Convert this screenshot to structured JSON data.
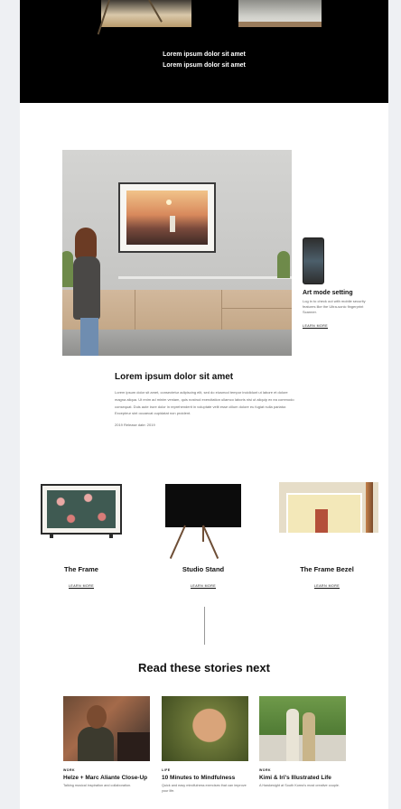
{
  "hero": {
    "line1": "Lorem ipsum dolor sit amet",
    "line2": "Lorem ipsum dolor sit amet"
  },
  "art_mode": {
    "title": "Art mode setting",
    "description": "Log in to check out with mobile security features like the Ultra-sonic fingerprint Scanner.",
    "link": "LEARN MORE"
  },
  "article": {
    "title": "Lorem ipsum dolor sit amet",
    "body": "Lorem ipsum dolor sit amet, consectetur adipiscing elit, sed do eiusmod tempor incididunt ut labore et dolore magna aliqua. Ut enim ad minim veniam, quis nostrud exercitation ullamco laboris nisi ut aliquip ex ea commodo consequat. Duis aute irure dolor in reprehenderit in voluptate velit esse cillum dolore eu fugiat nulla pariatur. Excepteur sint occaecat cupidatat non proident.",
    "date": "2019 Release date: 2019"
  },
  "products": [
    {
      "name": "The Frame",
      "link": "LEARN MORE"
    },
    {
      "name": "Studio Stand",
      "link": "LEARN MORE"
    },
    {
      "name": "The Frame Bezel",
      "link": "LEARN MORE"
    }
  ],
  "stories": {
    "title": "Read these stories next",
    "items": [
      {
        "category": "WORK",
        "title": "Helze + Marc Aliante Close-Up",
        "description": "Talking musical inspiration and collaboration."
      },
      {
        "category": "LIFE",
        "title": "10 Minutes to Mindfulness",
        "description": "Quick and easy mindfulness exercises that can improve your life."
      },
      {
        "category": "WORK",
        "title": "Kimi & Iri's Illustrated Life",
        "description": "A Hawkesight at South Korea's most creative couple."
      }
    ]
  }
}
